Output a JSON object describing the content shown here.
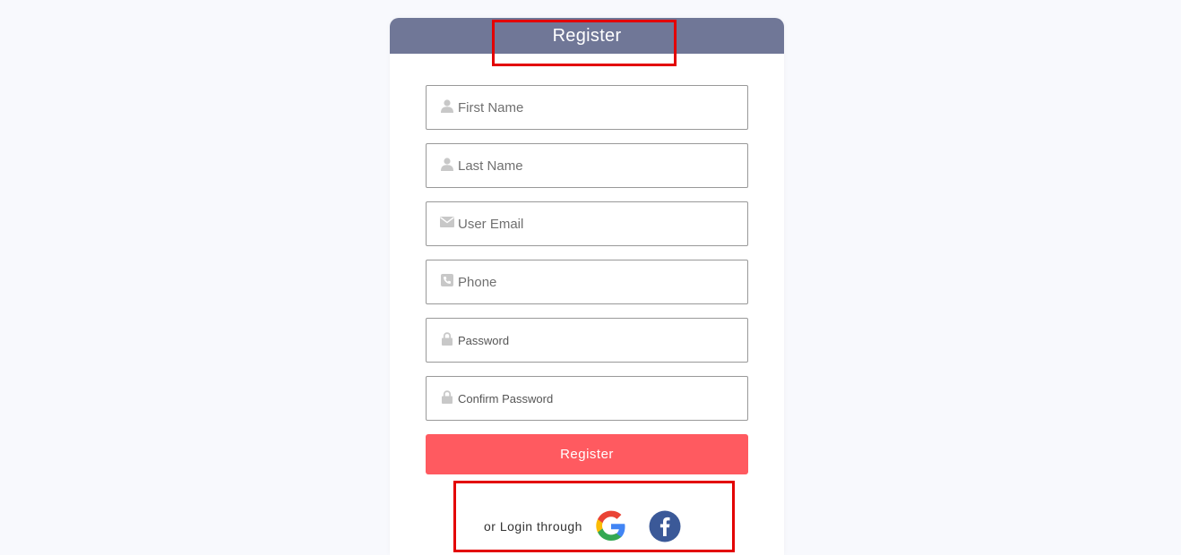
{
  "header": {
    "title": "Register"
  },
  "form": {
    "fields": [
      {
        "placeholder": "First Name",
        "icon": "user-icon"
      },
      {
        "placeholder": "Last Name",
        "icon": "user-icon"
      },
      {
        "placeholder": "User Email",
        "icon": "envelope-icon"
      },
      {
        "placeholder": "Phone",
        "icon": "phone-icon"
      },
      {
        "placeholder": "Password",
        "icon": "lock-icon"
      },
      {
        "placeholder": "Confirm Password",
        "icon": "lock-icon"
      }
    ],
    "submit_label": "Register"
  },
  "social": {
    "label": "or Login through",
    "providers": [
      "google-icon",
      "facebook-icon"
    ]
  },
  "colors": {
    "header_bg": "#707797",
    "button_bg": "#ff5a60",
    "page_bg": "#f8f9fd",
    "highlight": "#e30000",
    "facebook": "#3b5998"
  }
}
